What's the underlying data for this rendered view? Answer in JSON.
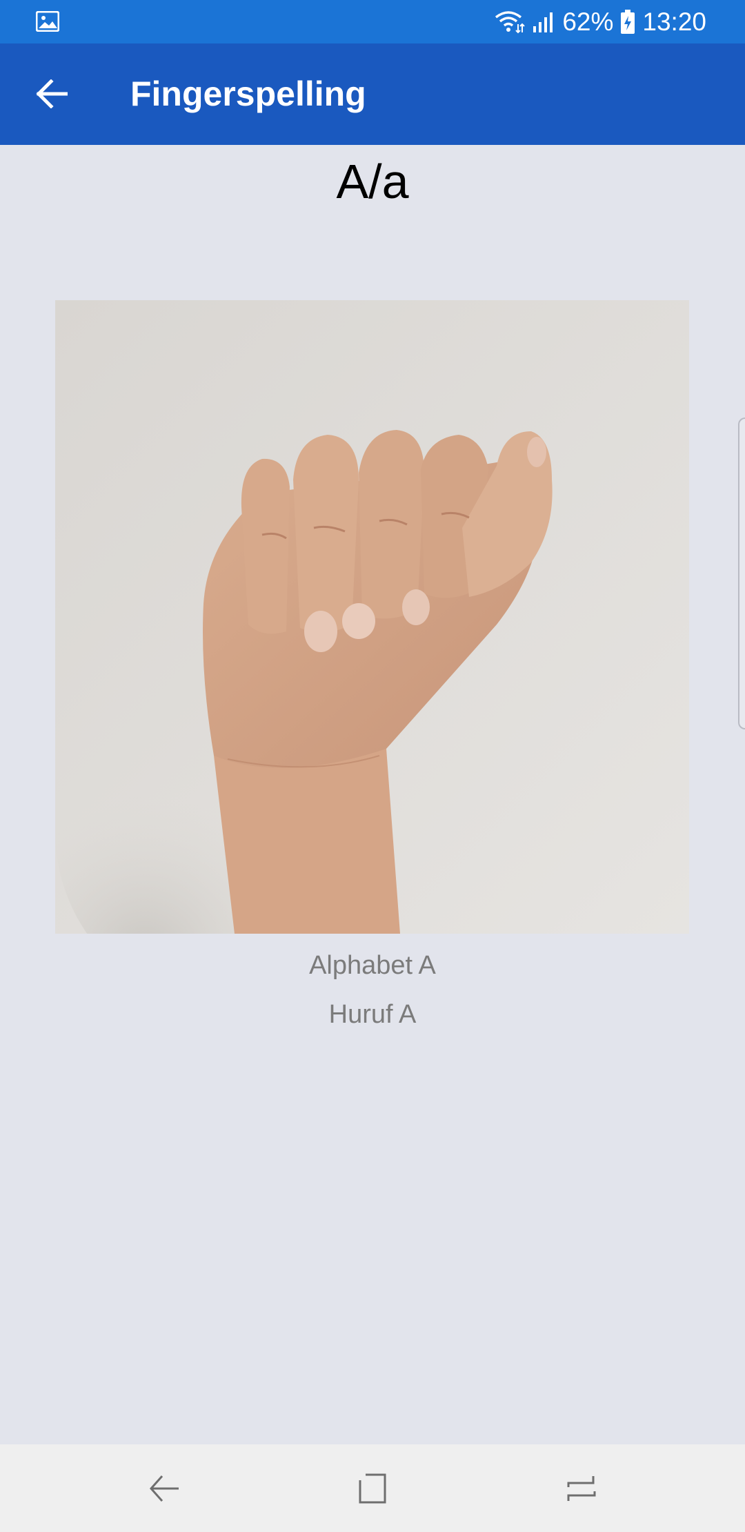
{
  "status_bar": {
    "battery": "62%",
    "time": "13:20",
    "icons": [
      "gallery-notification-icon",
      "wifi-icon",
      "signal-icon",
      "battery-charging-icon"
    ],
    "color": "#1b74d6"
  },
  "app_bar": {
    "title": "Fingerspelling",
    "back_icon": "arrow-left-icon",
    "color": "#1a59bf"
  },
  "content": {
    "letter": "A/a",
    "image": "hand-sign-letter-a",
    "caption_en": "Alphabet A",
    "caption_ms": "Huruf A",
    "background": "#e2e4ec"
  },
  "nav_bar": {
    "icons": [
      "back-icon",
      "home-icon",
      "recents-icon"
    ]
  }
}
